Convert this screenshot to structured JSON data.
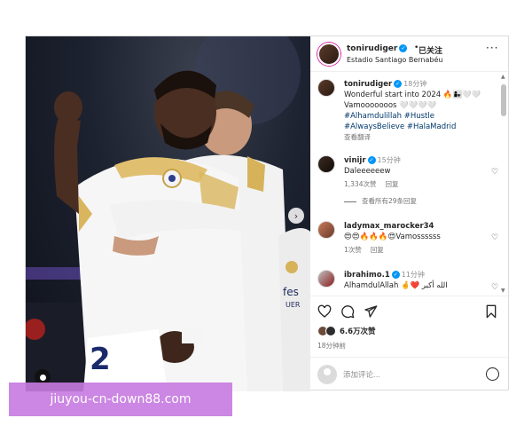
{
  "header": {
    "username": "tonirudiger",
    "separator": "•",
    "follow_status": "已关注",
    "location": "Estadio Santiago Bernabéu",
    "more": "···"
  },
  "caption": {
    "username": "tonirudiger",
    "time": "18分钟",
    "line1": "Wonderful start into 2024 🔥👩‍👧🤍🤍",
    "line2": "Vamooooooos 🤍🤍🤍🤍",
    "hashtags1": "#Alhamdulillah #Hustle",
    "hashtags2": "#AlwaysBelieve #HalaMadrid",
    "translate": "查看翻译"
  },
  "comments": [
    {
      "username": "vinijr",
      "time": "15分钟",
      "text": "Daleeeeeew",
      "likes": "1,334次赞",
      "reply": "回复",
      "view_replies": "查看所有29条回复"
    },
    {
      "username": "ladymax_marocker34",
      "time": "",
      "text": "😍😍🔥🔥🔥😍Vamossssss",
      "likes": "1次赞",
      "reply": "回复"
    },
    {
      "username": "ibrahimo.1",
      "time": "11分钟",
      "text": "AlhamdulAllah 🤞❤️ الله أكبر"
    }
  ],
  "actions": {
    "likes": "6.6万次赞",
    "posted": "18分钟前",
    "comment_placeholder": "添加评论...",
    "carousel_next": "›"
  },
  "photo": {
    "jersey_number": "2",
    "jersey_text": "fes",
    "jersey_text2": "UER"
  },
  "watermark": "jiuyou-cn-down88.com",
  "icons": [
    "verified-icon",
    "heart-icon",
    "comment-icon",
    "share-icon",
    "bookmark-icon",
    "emoji-icon",
    "tag-user-icon",
    "more-icon"
  ]
}
